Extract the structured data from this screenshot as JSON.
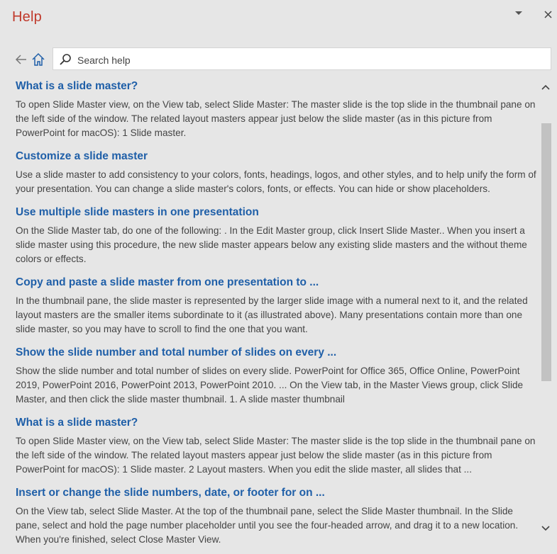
{
  "pane": {
    "title": "Help",
    "title_color": "#c0392b",
    "dropdown_icon": "chevron-down-icon",
    "close_icon": "close-icon"
  },
  "nav": {
    "back_icon": "back-arrow-icon",
    "home_icon": "home-icon",
    "search_icon": "search-icon",
    "search_placeholder": "Search help",
    "search_value": ""
  },
  "colors": {
    "link": "#1f5fa8",
    "text": "#444444",
    "background": "#e6e6e6"
  },
  "results": [
    {
      "title": "What is a slide master?",
      "snippet": "To open Slide Master view, on the View tab, select Slide Master: The master slide is the top slide in the thumbnail pane on the left side of the window. The related layout masters appear just below the slide master (as in this picture from PowerPoint for macOS): 1 Slide master."
    },
    {
      "title": "Customize a slide master",
      "snippet": "Use a slide master to add consistency to your colors, fonts, headings, logos, and other styles, and to help unify the form of your presentation. You can change a slide master's colors, fonts, or effects. You can hide or show placeholders."
    },
    {
      "title": "Use multiple slide masters in one presentation",
      "snippet": "On the Slide Master tab, do one of the following: . In the Edit Master group, click Insert Slide Master.. When you insert a slide master using this procedure, the new slide master appears below any existing slide masters and the without theme colors or effects."
    },
    {
      "title": "Copy and paste a slide master from one presentation to ...",
      "snippet": "In the thumbnail pane, the slide master is represented by the larger slide image with a numeral next to it, and the related layout masters are the smaller items subordinate to it (as illustrated above). Many presentations contain more than one slide master, so you may have to scroll to find the one that you want."
    },
    {
      "title": "Show the slide number and total number of slides on every ...",
      "snippet": "Show the slide number and total number of slides on every slide. PowerPoint for Office 365, Office Online, PowerPoint 2019, PowerPoint 2016, PowerPoint 2013, PowerPoint 2010. ... On the View tab, in the Master Views group, click Slide Master, and then click the slide master thumbnail. 1. A slide master thumbnail"
    },
    {
      "title": "What is a slide master?",
      "snippet": "To open Slide Master view, on the View tab, select Slide Master: The master slide is the top slide in the thumbnail pane on the left side of the window. The related layout masters appear just below the slide master (as in this picture from PowerPoint for macOS): 1 Slide master. 2 Layout masters. When you edit the slide master, all slides that ..."
    },
    {
      "title": "Insert or change the slide numbers, date, or footer for on ...",
      "snippet": "On the View tab, select Slide Master. At the top of the thumbnail pane, select the Slide Master thumbnail. In the Slide pane, select and hold the page number placeholder until you see the four-headed arrow, and drag it to a new location. When you're finished, select Close Master View."
    }
  ],
  "scrollbar": {
    "up_icon": "chevron-up-icon",
    "down_icon": "chevron-down-icon"
  }
}
